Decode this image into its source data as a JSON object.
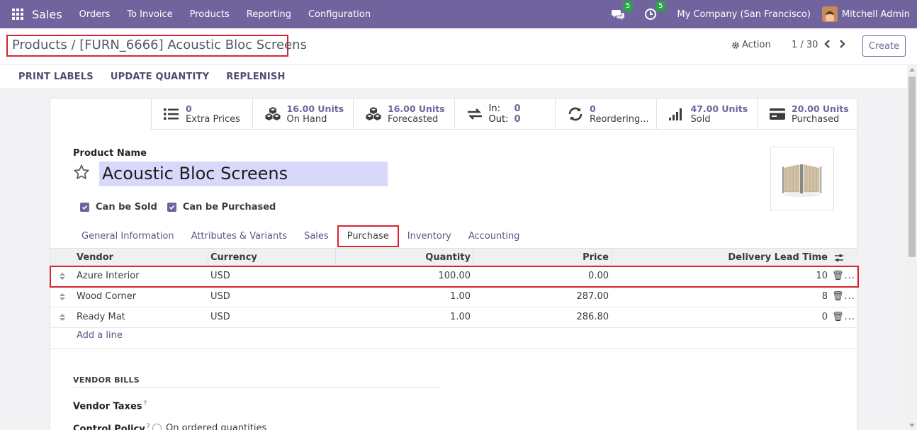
{
  "topbar": {
    "app_name": "Sales",
    "menu": [
      "Orders",
      "To Invoice",
      "Products",
      "Reporting",
      "Configuration"
    ],
    "messages_count": "5",
    "activities_count": "5",
    "company": "My Company (San Francisco)",
    "user": "Mitchell Admin",
    "bar_color": "#71639e"
  },
  "control": {
    "breadcrumb_parent": "Products",
    "breadcrumb_sep": "/",
    "breadcrumb_current": "[FURN_6666] Acoustic Bloc Screens",
    "action_label": "Action",
    "pager": "1 / 30",
    "create_label": "Create"
  },
  "statusbar": {
    "buttons": [
      "PRINT LABELS",
      "UPDATE QUANTITY",
      "REPLENISH"
    ]
  },
  "smart_buttons": {
    "extra_prices": {
      "value": "0",
      "label": "Extra Prices"
    },
    "on_hand": {
      "value": "16.00 Units",
      "label": "On Hand"
    },
    "forecasted": {
      "value": "16.00 Units",
      "label": "Forecasted"
    },
    "in_out": {
      "in_label": "In:",
      "in_value": "0",
      "out_label": "Out:",
      "out_value": "0"
    },
    "reordering": {
      "value": "0",
      "label": "Reordering..."
    },
    "sold": {
      "value": "47.00 Units",
      "label": "Sold"
    },
    "purchased": {
      "value": "20.00 Units",
      "label": "Purchased"
    }
  },
  "form": {
    "product_name_label": "Product Name",
    "product_name": "Acoustic Bloc Screens",
    "can_be_sold": "Can be Sold",
    "can_be_purchased": "Can be Purchased",
    "tabs": [
      "General Information",
      "Attributes & Variants",
      "Sales",
      "Purchase",
      "Inventory",
      "Accounting"
    ],
    "active_tab": "Purchase"
  },
  "vendor_table": {
    "headers": {
      "vendor": "Vendor",
      "currency": "Currency",
      "quantity": "Quantity",
      "price": "Price",
      "lead_time": "Delivery Lead Time"
    },
    "rows": [
      {
        "vendor": "Azure Interior",
        "currency": "USD",
        "quantity": "100.00",
        "price": "0.00",
        "lead_time": "10"
      },
      {
        "vendor": "Wood Corner",
        "currency": "USD",
        "quantity": "1.00",
        "price": "287.00",
        "lead_time": "8"
      },
      {
        "vendor": "Ready Mat",
        "currency": "USD",
        "quantity": "1.00",
        "price": "286.80",
        "lead_time": "0"
      }
    ],
    "row_action": "🗑...",
    "add_line": "Add a line"
  },
  "vendor_bills": {
    "section_title": "VENDOR BILLS",
    "vendor_taxes_label": "Vendor Taxes",
    "control_policy_label": "Control Policy",
    "help_mark": "?",
    "control_policy_option": "On ordered quantities"
  }
}
